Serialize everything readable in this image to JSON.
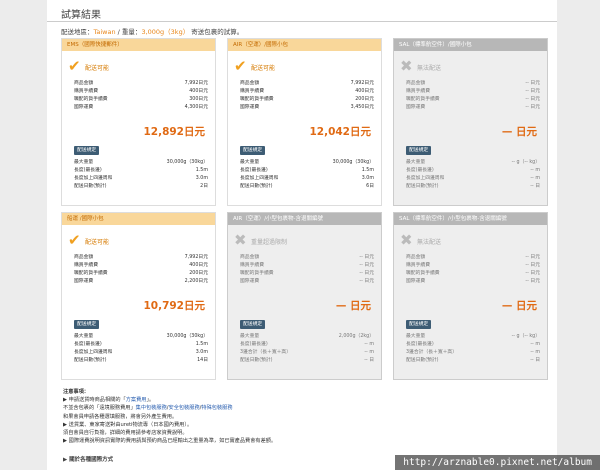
{
  "title": "試算結果",
  "summary": {
    "prefix": "配送地區：",
    "region": "Taiwan",
    "mid": " / 重量：",
    "weight": "3,000g（3kg）",
    "suffix": " 寄送包裹的試算。"
  },
  "cards": [
    {
      "name": "EMS（國際快捷郵件）",
      "available": true,
      "status": "配送可能",
      "rows": [
        {
          "label": "商品金額",
          "value": "7,992日元"
        },
        {
          "label": "購買手續費",
          "value": "400日元"
        },
        {
          "label": "職配的貨手續費",
          "value": "300日元"
        },
        {
          "label": "國際運費",
          "value": "4,300日元"
        }
      ],
      "total": "12,892日元",
      "button": "配送規定",
      "specs": [
        {
          "label": "最大重量",
          "value": "30,000g（30kg）"
        },
        {
          "label": "長度(最長邊)",
          "value": "1.5m"
        },
        {
          "label": "長度加上四邊周和",
          "value": "3.0m"
        },
        {
          "label": "配送日數(預計)",
          "value": "2日"
        }
      ]
    },
    {
      "name": "AIR（空運）/國際小包",
      "available": true,
      "status": "配送可能",
      "rows": [
        {
          "label": "商品金額",
          "value": "7,992日元"
        },
        {
          "label": "購買手續費",
          "value": "400日元"
        },
        {
          "label": "職配的貨手續費",
          "value": "200日元"
        },
        {
          "label": "國際運費",
          "value": "3,450日元"
        }
      ],
      "total": "12,042日元",
      "button": "配送規定",
      "specs": [
        {
          "label": "最大重量",
          "value": "30,000g（30kg）"
        },
        {
          "label": "長度(最長邊)",
          "value": "1.5m"
        },
        {
          "label": "長度加上四邊周和",
          "value": "3.0m"
        },
        {
          "label": "配送日數(預計)",
          "value": "6日"
        }
      ]
    },
    {
      "name": "SAL（標準航空件）/國際小包",
      "available": false,
      "status": "無法配送",
      "rows": [
        {
          "label": "商品金額",
          "value": "-- 日元"
        },
        {
          "label": "購買手續費",
          "value": "-- 日元"
        },
        {
          "label": "職配的貨手續費",
          "value": "-- 日元"
        },
        {
          "label": "國際運費",
          "value": "-- 日元"
        }
      ],
      "total": "— 日元",
      "button": "配送規定",
      "specs": [
        {
          "label": "最大重量",
          "value": "-- g（-- kg）"
        },
        {
          "label": "長度(最長邊)",
          "value": "-- m"
        },
        {
          "label": "長度加上四邊周和",
          "value": "-- m"
        },
        {
          "label": "配送日數(預計)",
          "value": "-- 日"
        }
      ]
    },
    {
      "name": "船運 /國際小包",
      "available": true,
      "status": "配送可能",
      "rows": [
        {
          "label": "商品金額",
          "value": "7,992日元"
        },
        {
          "label": "購買手續費",
          "value": "400日元"
        },
        {
          "label": "職配的貨手續費",
          "value": "200日元"
        },
        {
          "label": "國際運費",
          "value": "2,200日元"
        }
      ],
      "total": "10,792日元",
      "button": "配送規定",
      "specs": [
        {
          "label": "最大重量",
          "value": "30,000g（30kg）"
        },
        {
          "label": "長度(最長邊)",
          "value": "1.5m"
        },
        {
          "label": "長度加上四邊周和",
          "value": "3.0m"
        },
        {
          "label": "配送日數(預計)",
          "value": "14日"
        }
      ]
    },
    {
      "name": "AIR（空運）/小型包裹物-含退關編號",
      "available": false,
      "status": "重量超過限制",
      "rows": [
        {
          "label": "商品金額",
          "value": "-- 日元"
        },
        {
          "label": "購買手續費",
          "value": "-- 日元"
        },
        {
          "label": "職配的貨手續費",
          "value": "-- 日元"
        },
        {
          "label": "國際運費",
          "value": "-- 日元"
        }
      ],
      "total": "— 日元",
      "button": "配送規定",
      "specs": [
        {
          "label": "最大重量",
          "value": "2,000g（2kg）"
        },
        {
          "label": "長度(最長邊)",
          "value": "-- m"
        },
        {
          "label": "3邊合計（長＋寬＋高）",
          "value": "-- m"
        },
        {
          "label": "配送日數(預計)",
          "value": "-- 日"
        }
      ]
    },
    {
      "name": "SAL（標準航空件）/小型包裹物-含退關編號",
      "available": false,
      "status": "無法配送",
      "rows": [
        {
          "label": "商品金額",
          "value": "-- 日元"
        },
        {
          "label": "購買手續費",
          "value": "-- 日元"
        },
        {
          "label": "職配的貨手續費",
          "value": "-- 日元"
        },
        {
          "label": "國際運費",
          "value": "-- 日元"
        }
      ],
      "total": "— 日元",
      "button": "配送規定",
      "specs": [
        {
          "label": "最大重量",
          "value": "-- g（-- kg）"
        },
        {
          "label": "長度(最長邊)",
          "value": "-- m"
        },
        {
          "label": "3邊合計（長＋寬＋高）",
          "value": "-- m"
        },
        {
          "label": "配送日數(預計)",
          "value": "-- 日"
        }
      ]
    }
  ],
  "notes": {
    "heading": "注意事項：",
    "line1a": "▶ 申請送貨時商品相關的「",
    "line1link": "方案費用",
    "line1b": "」。",
    "line2a": "不並含包裹的「遠境服務費用」",
    "line2link1": "集中包裝服務",
    "line2mid": "/",
    "line2link2": "安全包裝服務",
    "line2link3": "特殊包裝服務",
    "line3": "和果會員申請各種選填服務，將會另外產生費用。",
    "line4": "▶ 送貨業、東家寄送對由ureti物流專（日本國內費用）。",
    "line5": "須自會員自行負擔，詳細的費用請參考店家資費說明。",
    "line6": "▶ 國際運費說明資訊實際的費用請與預約商品已經輸出之重量為準，如已實產品費會有差額。",
    "footer": "▶ 關於各種國際方式"
  },
  "watermark": "http://arznable0.pixnet.net/album"
}
